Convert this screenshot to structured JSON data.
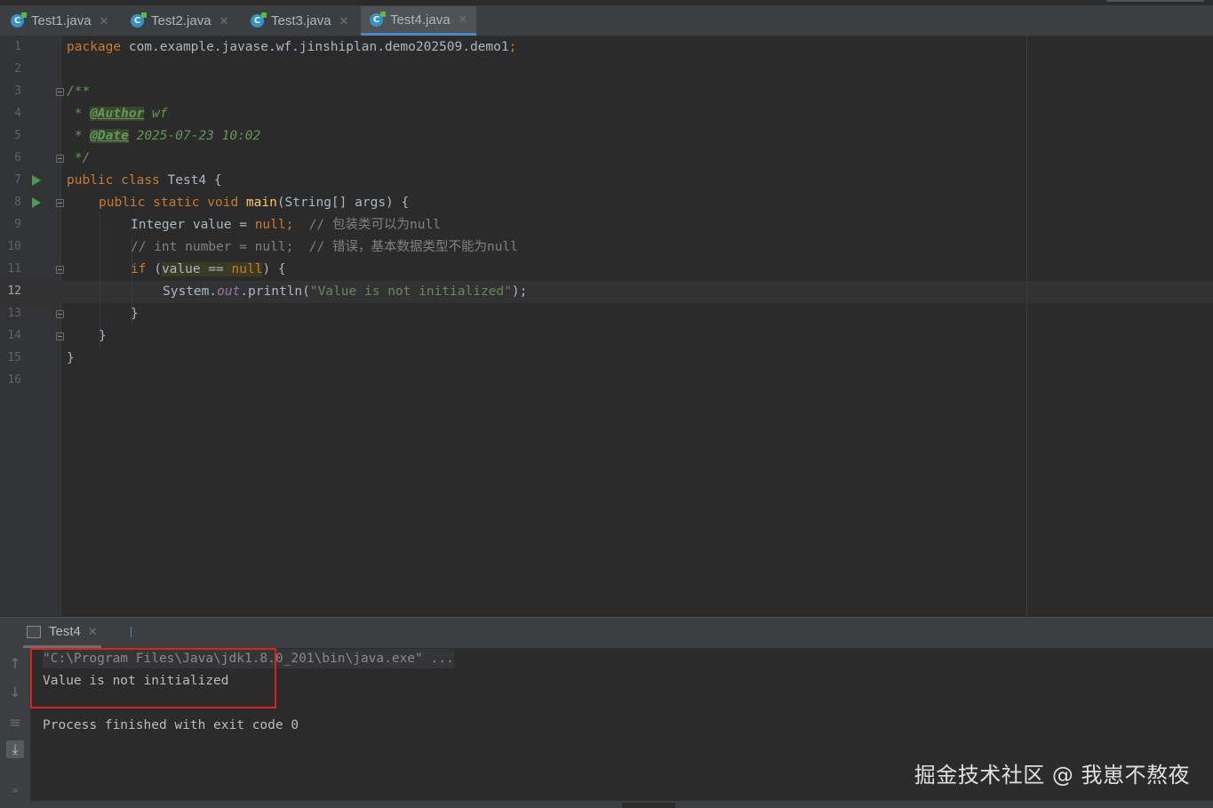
{
  "tabs": [
    {
      "label": "Test1.java",
      "active": false
    },
    {
      "label": "Test2.java",
      "active": false
    },
    {
      "label": "Test3.java",
      "active": false
    },
    {
      "label": "Test4.java",
      "active": true
    }
  ],
  "gutter": {
    "line_numbers": [
      "1",
      "2",
      "3",
      "4",
      "5",
      "6",
      "7",
      "8",
      "9",
      "10",
      "11",
      "12",
      "13",
      "14",
      "15",
      "16"
    ],
    "current_line": "12"
  },
  "code": {
    "l1": {
      "kw": "package",
      "rest": " com.example.javase.wf.jinshiplan.demo202509.demo1",
      "semi": ";"
    },
    "l3": "/**",
    "l4": {
      "star": " * ",
      "tag": "@Author",
      "val": " wf"
    },
    "l5": {
      "star": " * ",
      "tag": "@Date",
      "val": " 2025-07-23 10:02"
    },
    "l6": " */",
    "l7": {
      "kw1": "public",
      "kw2": "class",
      "name": " Test4 {"
    },
    "l8": {
      "kw1": "public",
      "kw2": "static",
      "kw3": "void",
      "fn": "main",
      "rest": "(String[] args) {"
    },
    "l9": {
      "type": "Integer value = ",
      "nul": "null",
      "semi": ";",
      "comment": "  // 包装类可以为null"
    },
    "l10": {
      "comment": "// int number = null;  // 错误，基本数据类型不能为null"
    },
    "l11": {
      "kw": "if",
      "open": " (",
      "var": "value == ",
      "nul": "null",
      "close": ") {"
    },
    "l12": {
      "obj": "System.",
      "field": "out",
      "dot": ".",
      "fn": "println",
      "open": "(",
      "str": "\"Value is not initialized\"",
      "close": ");"
    },
    "l13": "}",
    "l14": "}",
    "l15": "}"
  },
  "console": {
    "tab_label": "Test4",
    "command": "\"C:\\Program Files\\Java\\jdk1.8.0_201\\bin\\java.exe\" ...",
    "output": "Value is not initialized",
    "exit": "Process finished with exit code 0"
  },
  "watermark": "掘金技术社区 @ 我崽不熬夜",
  "colors": {
    "background": "#2b2b2b",
    "keyword": "#cc7832",
    "string": "#6a8759",
    "comment": "#808080",
    "doc": "#629755",
    "highlight_box": "#e02020",
    "run_icon": "#499c54"
  }
}
